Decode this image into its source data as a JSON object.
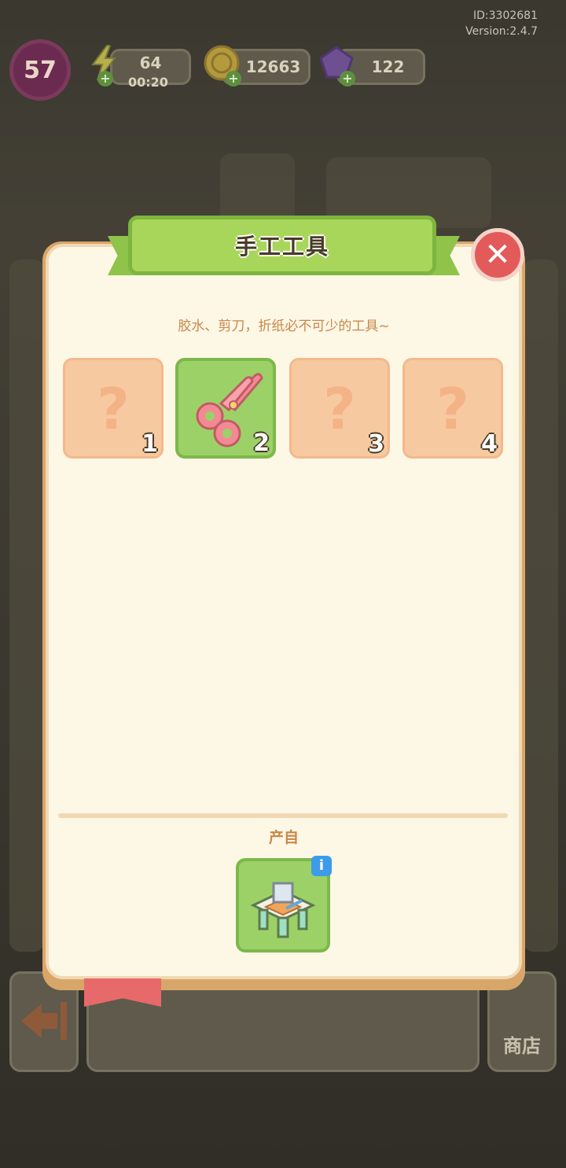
{
  "meta": {
    "id_text": "ID:3302681",
    "version_text": "Version:2.4.7"
  },
  "hud": {
    "level": "57",
    "energy": {
      "value": "64",
      "timer": "00:20"
    },
    "coins": "12663",
    "gems": "122"
  },
  "dialog": {
    "title": "手工工具",
    "description": "胶水、剪刀，折纸必不可少的工具~",
    "slots": [
      {
        "num": "1",
        "state": "locked",
        "icon": "question-mark"
      },
      {
        "num": "2",
        "state": "unlocked",
        "icon": "scissors-icon"
      },
      {
        "num": "3",
        "state": "locked",
        "icon": "question-mark"
      },
      {
        "num": "4",
        "state": "locked",
        "icon": "question-mark"
      }
    ],
    "source_label": "产自",
    "source_item_icon": "craft-table-icon",
    "close_icon": "close-icon",
    "info_icon": "i"
  },
  "bottom": {
    "shop_label": "商店"
  },
  "colors": {
    "panel": "#fdf7e6",
    "ribbon": "#a8d65a",
    "close": "#e35a5a",
    "slot_locked": "#f7c9a0",
    "slot_unlocked": "#9cd167"
  }
}
